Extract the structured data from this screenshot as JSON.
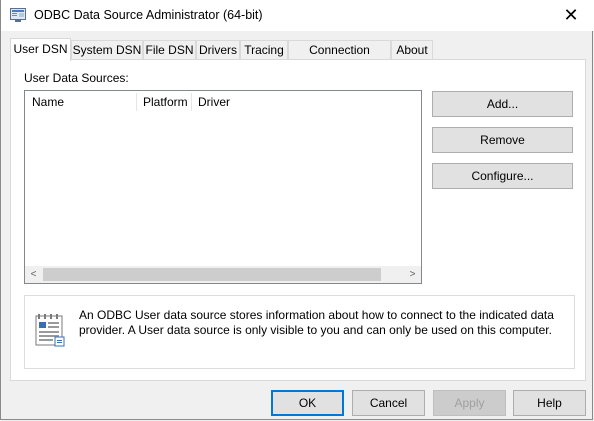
{
  "window": {
    "title": "ODBC Data Source Administrator (64-bit)",
    "close_glyph": "✕"
  },
  "tabs": [
    {
      "label": "User DSN",
      "active": true
    },
    {
      "label": "System DSN"
    },
    {
      "label": "File DSN"
    },
    {
      "label": "Drivers"
    },
    {
      "label": "Tracing"
    },
    {
      "label": "Connection Pooling"
    },
    {
      "label": "About"
    }
  ],
  "panel": {
    "section_label": "User Data Sources:",
    "columns": [
      "Name",
      "Platform",
      "Driver"
    ],
    "scroll_left": "<",
    "scroll_right": ">",
    "buttons": {
      "add": "Add...",
      "remove": "Remove",
      "configure": "Configure..."
    },
    "info_text": "An ODBC User data source stores information about how to connect to the indicated data provider.   A User data source is only visible to you and can only be used on this computer."
  },
  "footer": {
    "ok": "OK",
    "cancel": "Cancel",
    "apply": "Apply",
    "help": "Help"
  },
  "colors": {
    "accent": "#0078d7",
    "button_face": "#e1e1e1",
    "dialog_bg": "#f0f0f0"
  }
}
